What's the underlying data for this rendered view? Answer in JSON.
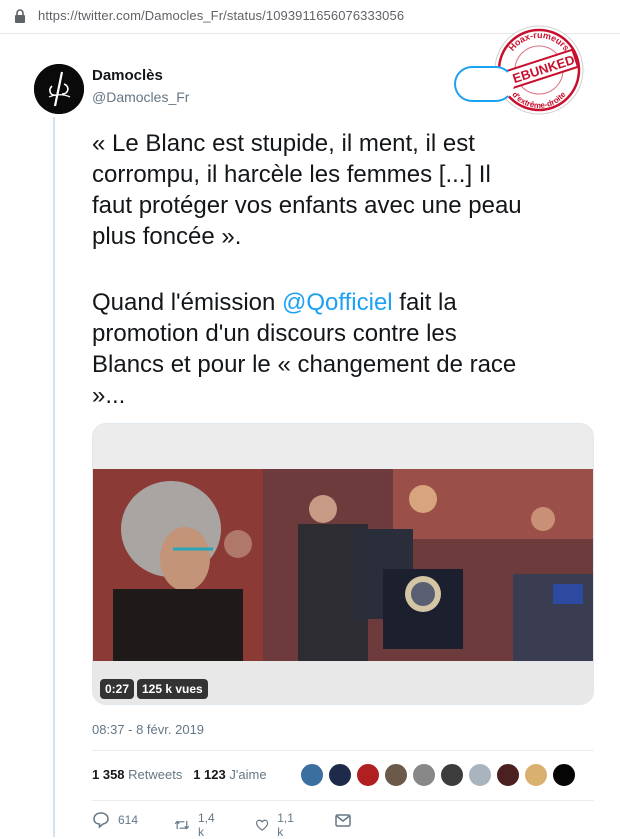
{
  "browser": {
    "url": "https://twitter.com/Damocles_Fr/status/1093911656076333056"
  },
  "stamp": {
    "top_text": "Hoax-rumeurs",
    "main_text": "DEBUNKED",
    "bottom_text": "d'extrême-droite"
  },
  "tweet": {
    "author": {
      "display_name": "Damoclès",
      "handle": "@Damocles_Fr"
    },
    "text_lines": [
      "« Le Blanc est stupide, il ment, il est",
      "corrompu, il harcèle les femmes [...] Il",
      "faut protéger vos enfants avec une peau",
      "plus foncée »."
    ],
    "text2_prefix": "Quand l'émission ",
    "mention": "@Qofficiel",
    "text2_suffix": " fait la",
    "text2_lines": [
      "promotion d'un discours contre les",
      "Blancs et pour le « changement de race",
      "»..."
    ],
    "video": {
      "duration": "0:27",
      "views": "125 k vues"
    },
    "timestamp": "08:37 - 8 févr. 2019",
    "stats": {
      "retweets_count": "1 358",
      "retweets_label": "Retweets",
      "likes_count": "1 123",
      "likes_label": "J'aime"
    },
    "actions": {
      "replies": "614",
      "retweets": "1,4 k",
      "likes": "1,1 k"
    }
  },
  "colors": {
    "accent": "#1da1f2",
    "text": "#14171a",
    "muted": "#657786",
    "stamp_red": "#c8102e"
  }
}
